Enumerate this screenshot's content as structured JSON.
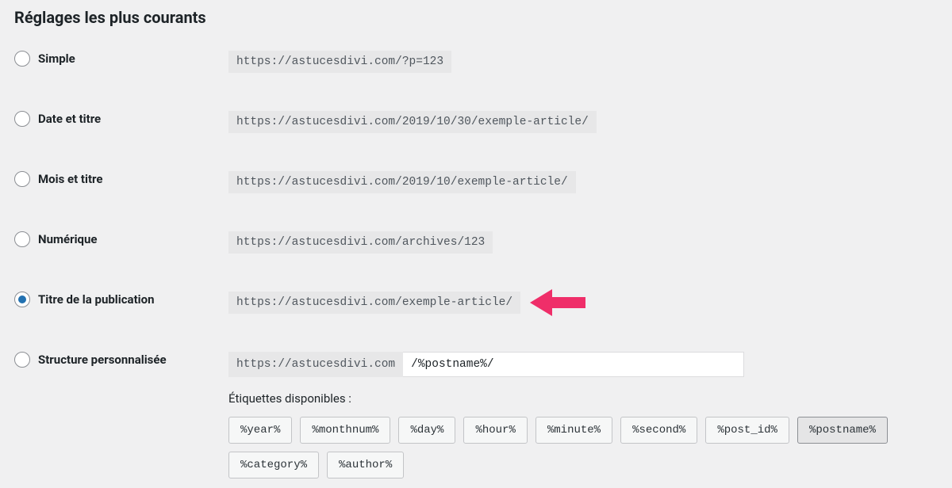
{
  "section_title": "Réglages les plus courants",
  "options": {
    "simple": {
      "label": "Simple",
      "url": "https://astucesdivi.com/?p=123"
    },
    "date": {
      "label": "Date et titre",
      "url": "https://astucesdivi.com/2019/10/30/exemple-article/"
    },
    "month": {
      "label": "Mois et titre",
      "url": "https://astucesdivi.com/2019/10/exemple-article/"
    },
    "numeric": {
      "label": "Numérique",
      "url": "https://astucesdivi.com/archives/123"
    },
    "postname": {
      "label": "Titre de la publication",
      "url": "https://astucesdivi.com/exemple-article/"
    },
    "custom": {
      "label": "Structure personnalisée",
      "prefix": "https://astucesdivi.com",
      "value": "/%postname%/"
    }
  },
  "tags_label": "Étiquettes disponibles :",
  "tags": [
    "%year%",
    "%monthnum%",
    "%day%",
    "%hour%",
    "%minute%",
    "%second%",
    "%post_id%",
    "%postname%",
    "%category%",
    "%author%"
  ],
  "active_tag": "%postname%"
}
